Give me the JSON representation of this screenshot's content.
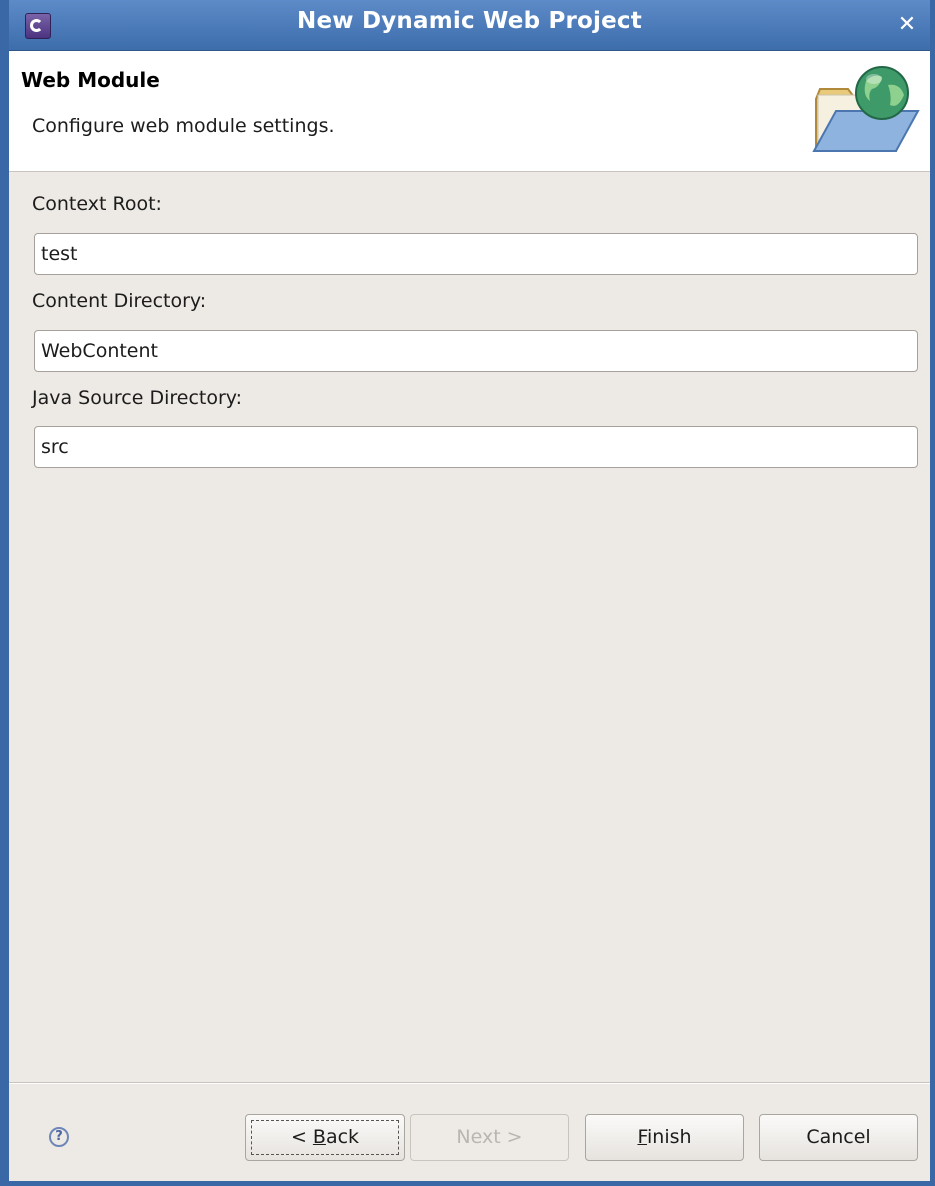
{
  "window": {
    "title": "New Dynamic Web Project",
    "close_glyph": "✕"
  },
  "header": {
    "title": "Web Module",
    "description": "Configure web module settings.",
    "icon": "web-folder-globe-icon"
  },
  "fields": {
    "context_root": {
      "label": "Context Root:",
      "value": "test"
    },
    "content_directory": {
      "label": "Content Directory:",
      "value": "WebContent"
    },
    "java_source_directory": {
      "label": "Java Source Directory:",
      "value": "src"
    }
  },
  "buttons": {
    "help": "?",
    "back": {
      "prefix": "< ",
      "mnemonic": "B",
      "rest": "ack",
      "enabled": true
    },
    "next": {
      "label": "Next >",
      "enabled": false
    },
    "finish": {
      "mnemonic": "F",
      "rest": "inish",
      "enabled": true
    },
    "cancel": {
      "label": "Cancel",
      "enabled": true
    }
  },
  "colors": {
    "title_bar": "#4a78b8",
    "dialog_background": "#edeae5",
    "header_background": "#ffffff"
  }
}
